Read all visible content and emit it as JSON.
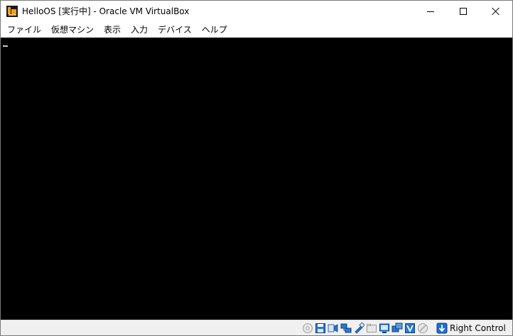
{
  "window": {
    "title": "HelloOS [実行中] - Oracle VM VirtualBox"
  },
  "menu": {
    "items": [
      "ファイル",
      "仮想マシン",
      "表示",
      "入力",
      "デバイス",
      "ヘルプ"
    ]
  },
  "statusbar": {
    "icons": [
      "optical-drive-icon",
      "floppy-disk-icon",
      "audio-icon",
      "network-icon",
      "usb-icon",
      "shared-folders-icon",
      "display-icon",
      "video-capture-icon",
      "vt-x-icon",
      "mouse-integration-icon",
      "host-key-arrow-icon"
    ],
    "host_key_label": "Right Control"
  },
  "colors": {
    "screen_bg": "#000000",
    "accent_blue": "#1e6fd0",
    "icon_orange": "#f0a020"
  }
}
